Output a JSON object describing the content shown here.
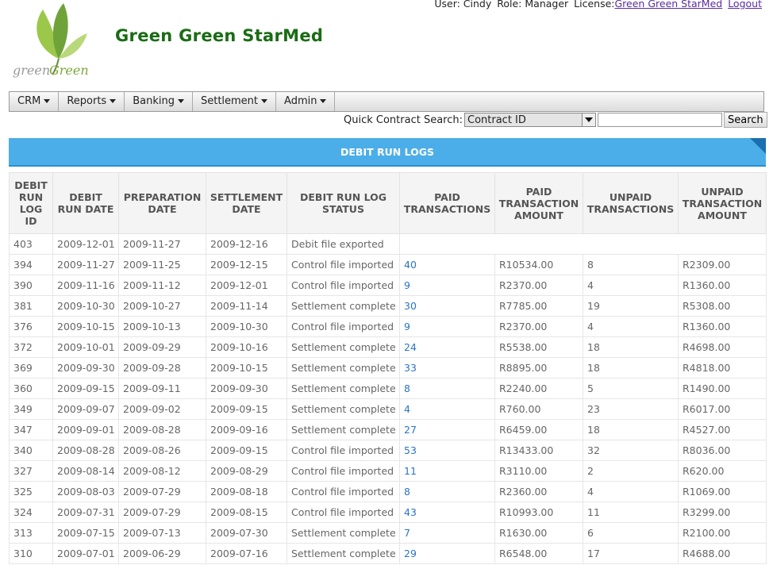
{
  "header": {
    "user_label": "User: Cindy",
    "role_label": "Role: Manager",
    "license_prefix": "License:",
    "license_link": "Green Green StarMed",
    "logout": "Logout",
    "brand_name": "Green Green StarMed",
    "logo_text_1": "green",
    "logo_text_2": "Green"
  },
  "menu": {
    "items": [
      {
        "label": "CRM"
      },
      {
        "label": "Reports"
      },
      {
        "label": "Banking"
      },
      {
        "label": "Settlement"
      },
      {
        "label": "Admin"
      }
    ]
  },
  "quick_search": {
    "label": "Quick Contract Search:",
    "selected": "Contract ID",
    "input_value": "",
    "button": "Search"
  },
  "page_title": "DEBIT RUN LOGS",
  "table": {
    "columns": [
      "DEBIT RUN LOG ID",
      "DEBIT RUN DATE",
      "PREPARATION DATE",
      "SETTLEMENT DATE",
      "DEBIT RUN LOG STATUS",
      "PAID TRANSACTIONS",
      "PAID TRANSACTION AMOUNT",
      "UNPAID TRANSACTIONS",
      "UNPAID TRANSACTION AMOUNT"
    ],
    "rows": [
      [
        "403",
        "2009-12-01",
        "2009-11-27",
        "2009-12-16",
        "Debit file exported",
        "",
        "",
        "",
        ""
      ],
      [
        "394",
        "2009-11-27",
        "2009-11-25",
        "2009-12-15",
        "Control file imported",
        "40",
        "R10534.00",
        "8",
        "R2309.00"
      ],
      [
        "390",
        "2009-11-16",
        "2009-11-12",
        "2009-12-01",
        "Control file imported",
        "9",
        "R2370.00",
        "4",
        "R1360.00"
      ],
      [
        "381",
        "2009-10-30",
        "2009-10-27",
        "2009-11-14",
        "Settlement complete",
        "30",
        "R7785.00",
        "19",
        "R5308.00"
      ],
      [
        "376",
        "2009-10-15",
        "2009-10-13",
        "2009-10-30",
        "Control file imported",
        "9",
        "R2370.00",
        "4",
        "R1360.00"
      ],
      [
        "372",
        "2009-10-01",
        "2009-09-29",
        "2009-10-16",
        "Settlement complete",
        "24",
        "R5538.00",
        "18",
        "R4698.00"
      ],
      [
        "369",
        "2009-09-30",
        "2009-09-28",
        "2009-10-15",
        "Settlement complete",
        "33",
        "R8895.00",
        "18",
        "R4818.00"
      ],
      [
        "360",
        "2009-09-15",
        "2009-09-11",
        "2009-09-30",
        "Settlement complete",
        "8",
        "R2240.00",
        "5",
        "R1490.00"
      ],
      [
        "349",
        "2009-09-07",
        "2009-09-02",
        "2009-09-15",
        "Settlement complete",
        "4",
        "R760.00",
        "23",
        "R6017.00"
      ],
      [
        "347",
        "2009-09-01",
        "2009-08-28",
        "2009-09-16",
        "Settlement complete",
        "27",
        "R6459.00",
        "18",
        "R4527.00"
      ],
      [
        "340",
        "2009-08-28",
        "2009-08-26",
        "2009-09-15",
        "Control file imported",
        "53",
        "R13433.00",
        "32",
        "R8036.00"
      ],
      [
        "327",
        "2009-08-14",
        "2009-08-12",
        "2009-08-29",
        "Control file imported",
        "11",
        "R3110.00",
        "2",
        "R620.00"
      ],
      [
        "325",
        "2009-08-03",
        "2009-07-29",
        "2009-08-18",
        "Control file imported",
        "8",
        "R2360.00",
        "4",
        "R1069.00"
      ],
      [
        "324",
        "2009-07-31",
        "2009-07-29",
        "2009-08-15",
        "Control file imported",
        "43",
        "R10993.00",
        "11",
        "R3299.00"
      ],
      [
        "313",
        "2009-07-15",
        "2009-07-13",
        "2009-07-30",
        "Settlement complete",
        "7",
        "R1630.00",
        "6",
        "R2100.00"
      ],
      [
        "310",
        "2009-07-01",
        "2009-06-29",
        "2009-07-16",
        "Settlement complete",
        "29",
        "R6548.00",
        "17",
        "R4688.00"
      ]
    ]
  },
  "colors": {
    "brand_green": "#1a6c14",
    "title_bar": "#4caee8",
    "link": "#2a74c4"
  }
}
